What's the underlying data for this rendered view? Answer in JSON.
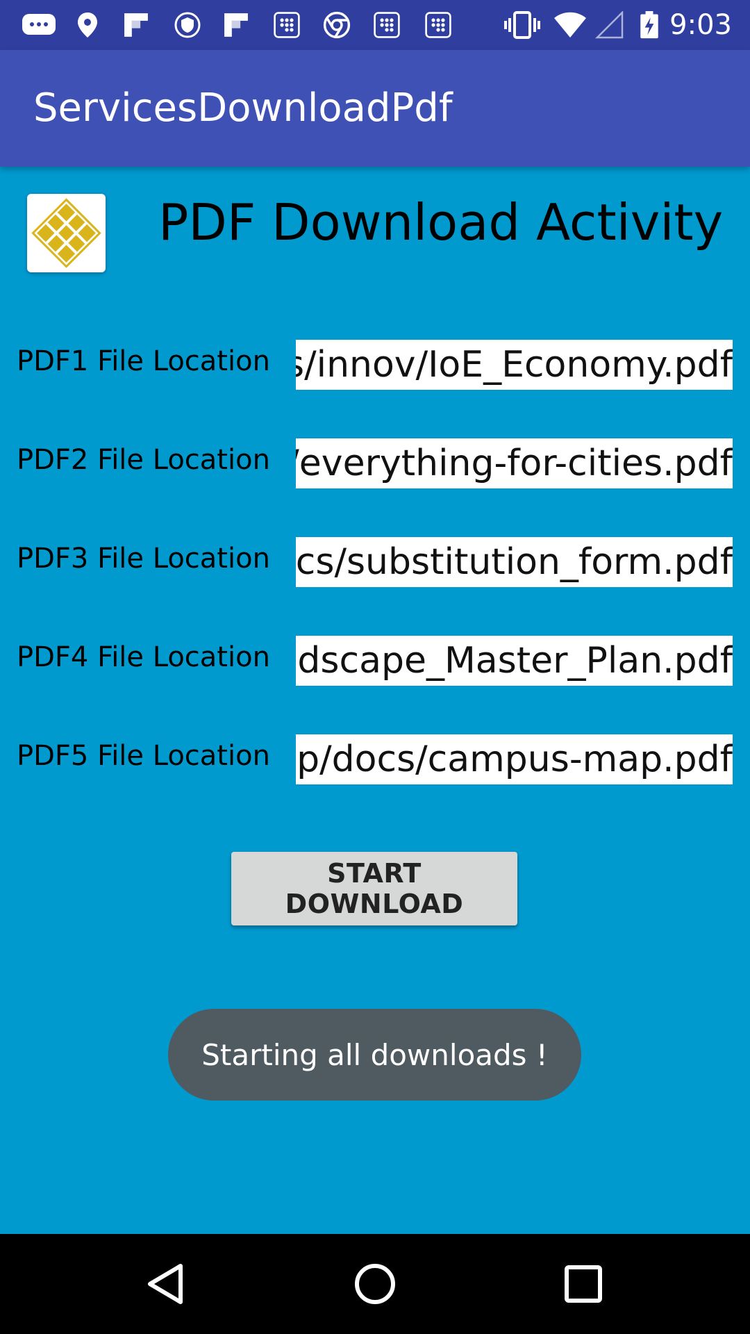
{
  "status_bar": {
    "time": "9:03",
    "icons": [
      "messages-icon",
      "location-icon",
      "flipboard-icon",
      "vpn-icon",
      "flipboard-icon",
      "app-grid-icon",
      "chrome-icon",
      "app-grid-icon",
      "app-grid-icon",
      "vibrate-icon",
      "wifi-icon",
      "signal-icon",
      "battery-charging-icon"
    ]
  },
  "app_bar": {
    "title": "ServicesDownloadPdf"
  },
  "main": {
    "heading": "PDF Download Activity",
    "rows": [
      {
        "label": "PDF1 File Location",
        "value": "cs/innov/IoE_Economy.pdf"
      },
      {
        "label": "PDF2 File Location",
        "value": "ov/everything-for-cities.pdf"
      },
      {
        "label": "PDF3 File Location",
        "value": "ocs/substitution_form.pdf"
      },
      {
        "label": "PDF4 File Location",
        "value": "andscape_Master_Plan.pdf"
      },
      {
        "label": "PDF5 File Location",
        "value": "ap/docs/campus-map.pdf"
      }
    ],
    "start_button_label": "START DOWNLOAD"
  },
  "toast": {
    "message": "Starting all downloads !"
  },
  "nav_bar": {
    "buttons": [
      "back-icon",
      "home-icon",
      "recents-icon"
    ]
  },
  "colors": {
    "background": "#019ACF",
    "app_bar": "#3F51B5",
    "status_bar": "#303F9F",
    "toast": "#4F5B61",
    "button": "#D6D7D7",
    "logo_gold": "#D9B41A"
  }
}
